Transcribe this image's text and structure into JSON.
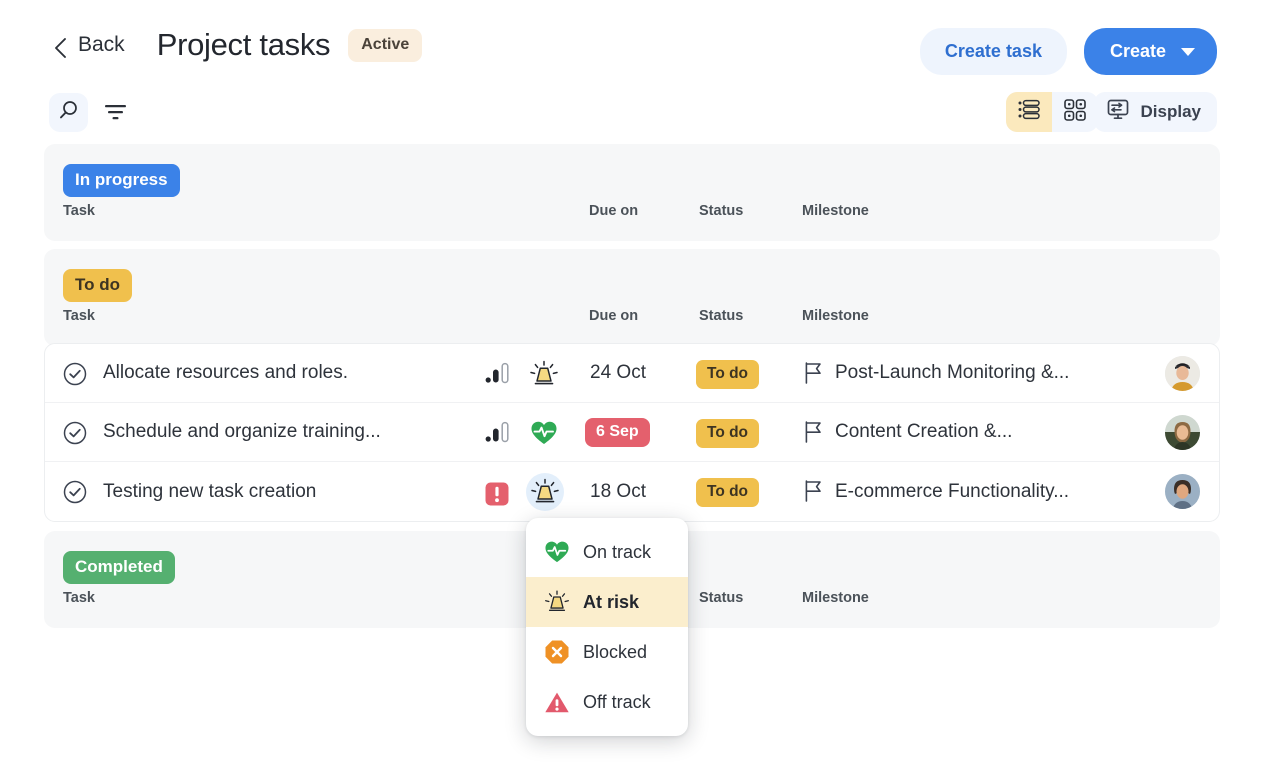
{
  "header": {
    "back_label": "Back",
    "title": "Project tasks",
    "status_pill": "Active",
    "create_task_label": "Create task",
    "create_label": "Create"
  },
  "toolbar": {
    "search_icon": "search-icon",
    "filter_icon": "filter-icon",
    "list_view_icon": "list-view-icon",
    "grid_view_icon": "grid-view-icon",
    "display_label": "Display",
    "display_icon": "display-settings-icon",
    "active_view": "list"
  },
  "columns": {
    "task": "Task",
    "due_on": "Due on",
    "status": "Status",
    "milestone": "Milestone"
  },
  "sections": [
    {
      "label": "In progress",
      "color": "#3b82e8",
      "text_color": "#ffffff"
    },
    {
      "label": "To do",
      "color": "#f0c04d",
      "text_color": "#3d3422"
    },
    {
      "label": "Completed",
      "color": "#55b070",
      "text_color": "#ffffff"
    }
  ],
  "rows": [
    {
      "name": "Allocate resources and roles.",
      "priority": "medium",
      "health": "at-risk",
      "health_active": false,
      "due": "24 Oct",
      "due_overdue": false,
      "status": "To do",
      "milestone": "Post-Launch Monitoring &...",
      "avatar": "avatar-1"
    },
    {
      "name": "Schedule and organize training...",
      "priority": "medium",
      "health": "on-track",
      "health_active": false,
      "due": "6 Sep",
      "due_overdue": true,
      "status": "To do",
      "milestone": "Content Creation &...",
      "avatar": "avatar-2"
    },
    {
      "name": "Testing new task creation",
      "priority": "high",
      "health": "at-risk",
      "health_active": true,
      "due": "18 Oct",
      "due_overdue": false,
      "status": "To do",
      "milestone": "E-commerce Functionality...",
      "avatar": "avatar-3"
    }
  ],
  "dropdown": {
    "items": [
      {
        "label": "On track",
        "icon": "heart-pulse-icon",
        "selected": false
      },
      {
        "label": "At risk",
        "icon": "siren-icon",
        "selected": true
      },
      {
        "label": "Blocked",
        "icon": "octagon-x-icon",
        "selected": false
      },
      {
        "label": "Off track",
        "icon": "warning-triangle-icon",
        "selected": false
      }
    ]
  },
  "colors": {
    "accent_blue": "#3b82e8",
    "pill_yellow": "#f0c04d",
    "green": "#55b070",
    "overdue_red": "#e4606d",
    "highlight_yellow": "#fbeecd",
    "page_bg": "#ffffff",
    "section_bg": "#f6f7f8"
  }
}
